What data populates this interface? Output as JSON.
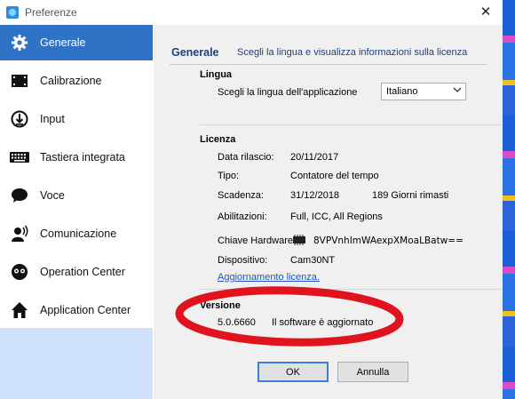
{
  "window": {
    "title": "Preferenze",
    "close": "✕"
  },
  "sidebar": {
    "items": [
      {
        "label": "Generale",
        "icon": "gear-icon"
      },
      {
        "label": "Calibrazione",
        "icon": "screen-icon"
      },
      {
        "label": "Input",
        "icon": "input-icon"
      },
      {
        "label": "Tastiera integrata",
        "icon": "keyboard-icon"
      },
      {
        "label": "Voce",
        "icon": "speech-bubble-icon"
      },
      {
        "label": "Comunicazione",
        "icon": "communication-icon"
      },
      {
        "label": "Operation Center",
        "icon": "eyes-icon"
      },
      {
        "label": "Application Center",
        "icon": "home-icon"
      }
    ]
  },
  "header": {
    "title": "Generale",
    "subtitle": "Scegli la lingua e visualizza informazioni sulla licenza"
  },
  "lingua": {
    "title": "Lingua",
    "label": "Scegli la lingua dell'applicazione",
    "selected": "Italiano"
  },
  "licenza": {
    "title": "Licenza",
    "data_rilascio_label": "Data rilascio:",
    "data_rilascio": "20/11/2017",
    "tipo_label": "Tipo:",
    "tipo": "Contatore del tempo",
    "scadenza_label": "Scadenza:",
    "scadenza": "31/12/2018",
    "giorni_rimasti": "189 Giorni rimasti",
    "abilitazioni_label": "Abilitazioni:",
    "abilitazioni": "Full, ICC, All Regions",
    "chiave_label": "Chiave Hardware:",
    "chiave": "8VPVnhImWAexpXMoaLBatw==",
    "dispositivo_label": "Dispositivo:",
    "dispositivo": "Cam30NT",
    "update_link": "Aggiornamento licenza."
  },
  "versione": {
    "title": "Versione",
    "number": "5.0.6660",
    "status": "Il software è aggiornato"
  },
  "buttons": {
    "ok": "OK",
    "cancel": "Annulla"
  },
  "colors": {
    "accent": "#2f73c7",
    "sidebar_bottom": "#cfe1fb",
    "annotation": "#e0141e",
    "header_text": "#1f3f7a"
  }
}
